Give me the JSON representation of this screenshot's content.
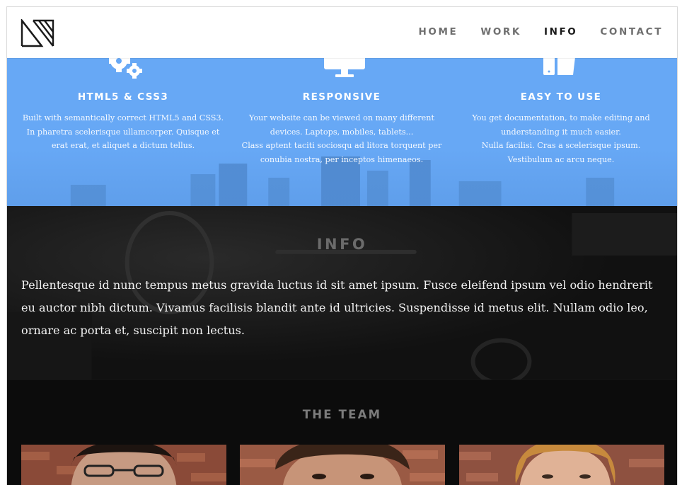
{
  "header": {
    "logo_icon": "monogram-logo",
    "nav": [
      {
        "label": "HOME",
        "active": false
      },
      {
        "label": "WORK",
        "active": false
      },
      {
        "label": "INFO",
        "active": true
      },
      {
        "label": "CONTACT",
        "active": false
      }
    ]
  },
  "features": {
    "background_color": "#67a8f5",
    "items": [
      {
        "icon": "gears-icon",
        "title": "HTML5 & CSS3",
        "lines": [
          "Built with semantically correct HTML5 and CSS3.",
          "In pharetra scelerisque ullamcorper. Quisque et",
          "erat erat, et aliquet a dictum tellus."
        ]
      },
      {
        "icon": "monitor-icon",
        "title": "RESPONSIVE",
        "lines": [
          "Your website can be viewed on many different",
          "devices. Laptops, mobiles, tablets...",
          "Class aptent taciti sociosqu ad litora torquent per",
          "conubia nostra, per inceptos himenaeos."
        ]
      },
      {
        "icon": "devices-icon",
        "title": "EASY TO USE",
        "lines": [
          "You get documentation, to make editing and",
          "understanding it much easier.",
          "Nulla facilisi. Cras a scelerisque ipsum.",
          "Vestibulum ac arcu neque."
        ]
      }
    ]
  },
  "info": {
    "title": "INFO",
    "body": "Pellentesque id nunc tempus metus gravida luctus id sit amet ipsum. Fusce eleifend ipsum vel odio hendrerit eu auctor nibh dictum. Vivamus facilisis blandit ante id ultricies. Suspendisse id metus elit. Nullam odio leo, ornare ac porta et, suscipit non lectus."
  },
  "team": {
    "title": "THE TEAM",
    "members": [
      {
        "photo": "team-member-photo"
      },
      {
        "photo": "team-member-photo"
      },
      {
        "photo": "team-member-photo"
      }
    ]
  }
}
